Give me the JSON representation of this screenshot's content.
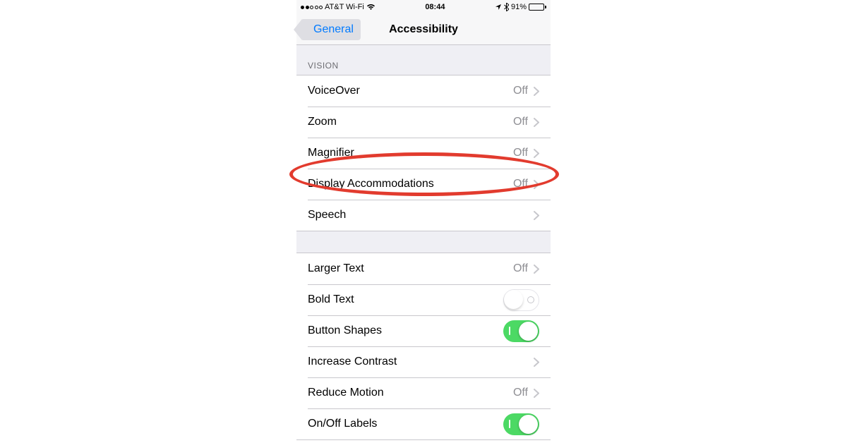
{
  "status": {
    "carrier": "AT&T Wi-Fi",
    "time": "08:44",
    "battery_pct": "91%"
  },
  "nav": {
    "back_label": "General",
    "title": "Accessibility"
  },
  "sections": {
    "vision_header": "VISION"
  },
  "rows": {
    "voiceover": {
      "label": "VoiceOver",
      "value": "Off"
    },
    "zoom": {
      "label": "Zoom",
      "value": "Off"
    },
    "magnifier": {
      "label": "Magnifier",
      "value": "Off"
    },
    "display_accommodations": {
      "label": "Display Accommodations",
      "value": "Off"
    },
    "speech": {
      "label": "Speech"
    },
    "larger_text": {
      "label": "Larger Text",
      "value": "Off"
    },
    "bold_text": {
      "label": "Bold Text",
      "switch": false
    },
    "button_shapes": {
      "label": "Button Shapes",
      "switch": true
    },
    "increase_contrast": {
      "label": "Increase Contrast"
    },
    "reduce_motion": {
      "label": "Reduce Motion",
      "value": "Off"
    },
    "onoff_labels": {
      "label": "On/Off Labels",
      "switch": true
    }
  },
  "annotation": {
    "highlighted_row": "magnifier",
    "color": "#e23b2e"
  }
}
